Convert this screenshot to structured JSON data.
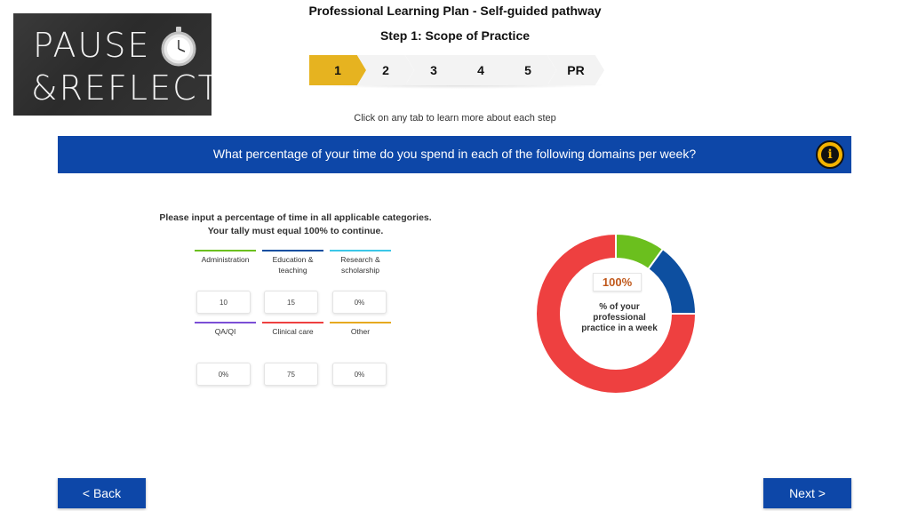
{
  "logo": {
    "line1": "PAUSE",
    "line2": "&REFLECT",
    "icon": "stopwatch-icon"
  },
  "header": {
    "title": "Professional Learning Plan - Self-guided pathway",
    "subtitle": "Step 1: Scope of Practice"
  },
  "steps": [
    {
      "label": "1",
      "active": true
    },
    {
      "label": "2",
      "active": false
    },
    {
      "label": "3",
      "active": false
    },
    {
      "label": "4",
      "active": false
    },
    {
      "label": "5",
      "active": false
    },
    {
      "label": "PR",
      "active": false
    }
  ],
  "hint": "Click on any tab to learn more about each step",
  "banner": {
    "question": "What percentage of your time do you spend in each of the following domains per week?",
    "info_icon": "i"
  },
  "instructions": {
    "line1": "Please input a percentage of time in all applicable categories.",
    "line2": "Your tally must equal 100% to continue."
  },
  "categories": [
    {
      "label": "Administration",
      "value": "10",
      "color": "#6bbf1e"
    },
    {
      "label": "Education & teaching",
      "value": "15",
      "color": "#0d4fa0"
    },
    {
      "label": "Research & scholarship",
      "value": "0%",
      "color": "#3cc7e8"
    },
    {
      "label": "QA/QI",
      "value": "0%",
      "color": "#7b4fd6"
    },
    {
      "label": "Clinical care",
      "value": "75",
      "color": "#ee4040"
    },
    {
      "label": "Other",
      "value": "0%",
      "color": "#e6a920"
    }
  ],
  "chart_data": {
    "type": "pie",
    "categories": [
      "Administration",
      "Education & teaching",
      "Clinical care"
    ],
    "values": [
      10,
      15,
      75
    ],
    "colors": [
      "#6bbf1e",
      "#0d4fa0",
      "#ee4040"
    ],
    "center_value": "100%",
    "center_label": "% of your professional practice in a week"
  },
  "nav": {
    "back": "< Back",
    "next": "Next >"
  }
}
